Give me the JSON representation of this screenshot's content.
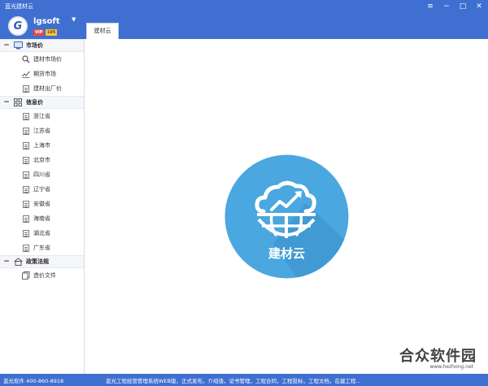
{
  "window": {
    "title": "蓝光建材云",
    "controls": {
      "menu_icon": "hamburger-icon",
      "minimize_icon": "minimize-icon",
      "maximize_icon": "maximize-icon",
      "close_icon": "close-icon"
    }
  },
  "header": {
    "logo_letter": "G",
    "username": "lgsoft",
    "badges": {
      "vip": "VIP",
      "level": "LV6"
    },
    "dropdown": "▼",
    "tabs": [
      {
        "label": "建材云"
      }
    ]
  },
  "sidebar": {
    "groups": [
      {
        "label": "市场价",
        "toggle": "−",
        "icon": "monitor-icon",
        "items": [
          {
            "label": "建材市场价",
            "icon": "search-icon"
          },
          {
            "label": "期货市场",
            "icon": "chart-line-icon"
          },
          {
            "label": "建材出厂价",
            "icon": "document-icon"
          }
        ]
      },
      {
        "label": "信息价",
        "toggle": "−",
        "icon": "grid-icon",
        "items": [
          {
            "label": "浙江省",
            "icon": "document-icon"
          },
          {
            "label": "江苏省",
            "icon": "document-icon"
          },
          {
            "label": "上海市",
            "icon": "document-icon"
          },
          {
            "label": "北京市",
            "icon": "document-icon"
          },
          {
            "label": "四川省",
            "icon": "document-icon"
          },
          {
            "label": "辽宁省",
            "icon": "document-icon"
          },
          {
            "label": "安徽省",
            "icon": "document-icon"
          },
          {
            "label": "海南省",
            "icon": "document-icon"
          },
          {
            "label": "湖北省",
            "icon": "document-icon"
          },
          {
            "label": "广东省",
            "icon": "document-icon"
          }
        ]
      },
      {
        "label": "政策法规",
        "toggle": "−",
        "icon": "home-icon",
        "items": [
          {
            "label": "造价文件",
            "icon": "files-icon"
          }
        ]
      }
    ]
  },
  "main": {
    "emblem": {
      "label": "建材云",
      "icon": "cloud-globe-icon",
      "color": "#4aa7e0"
    }
  },
  "statusbar": {
    "contact": "蓝光软件 400-860-8918",
    "ticker": "蓝光工程经营管理系统WEB版，正式发布，介绍值，证书管理，工程合同，工程投标，工程文档，在建工程..."
  },
  "watermark": {
    "main": "合众软件园",
    "sub": "www.hezhong.net"
  },
  "colors": {
    "accent": "#3f6fd1",
    "emblem": "#4aa7e0"
  }
}
